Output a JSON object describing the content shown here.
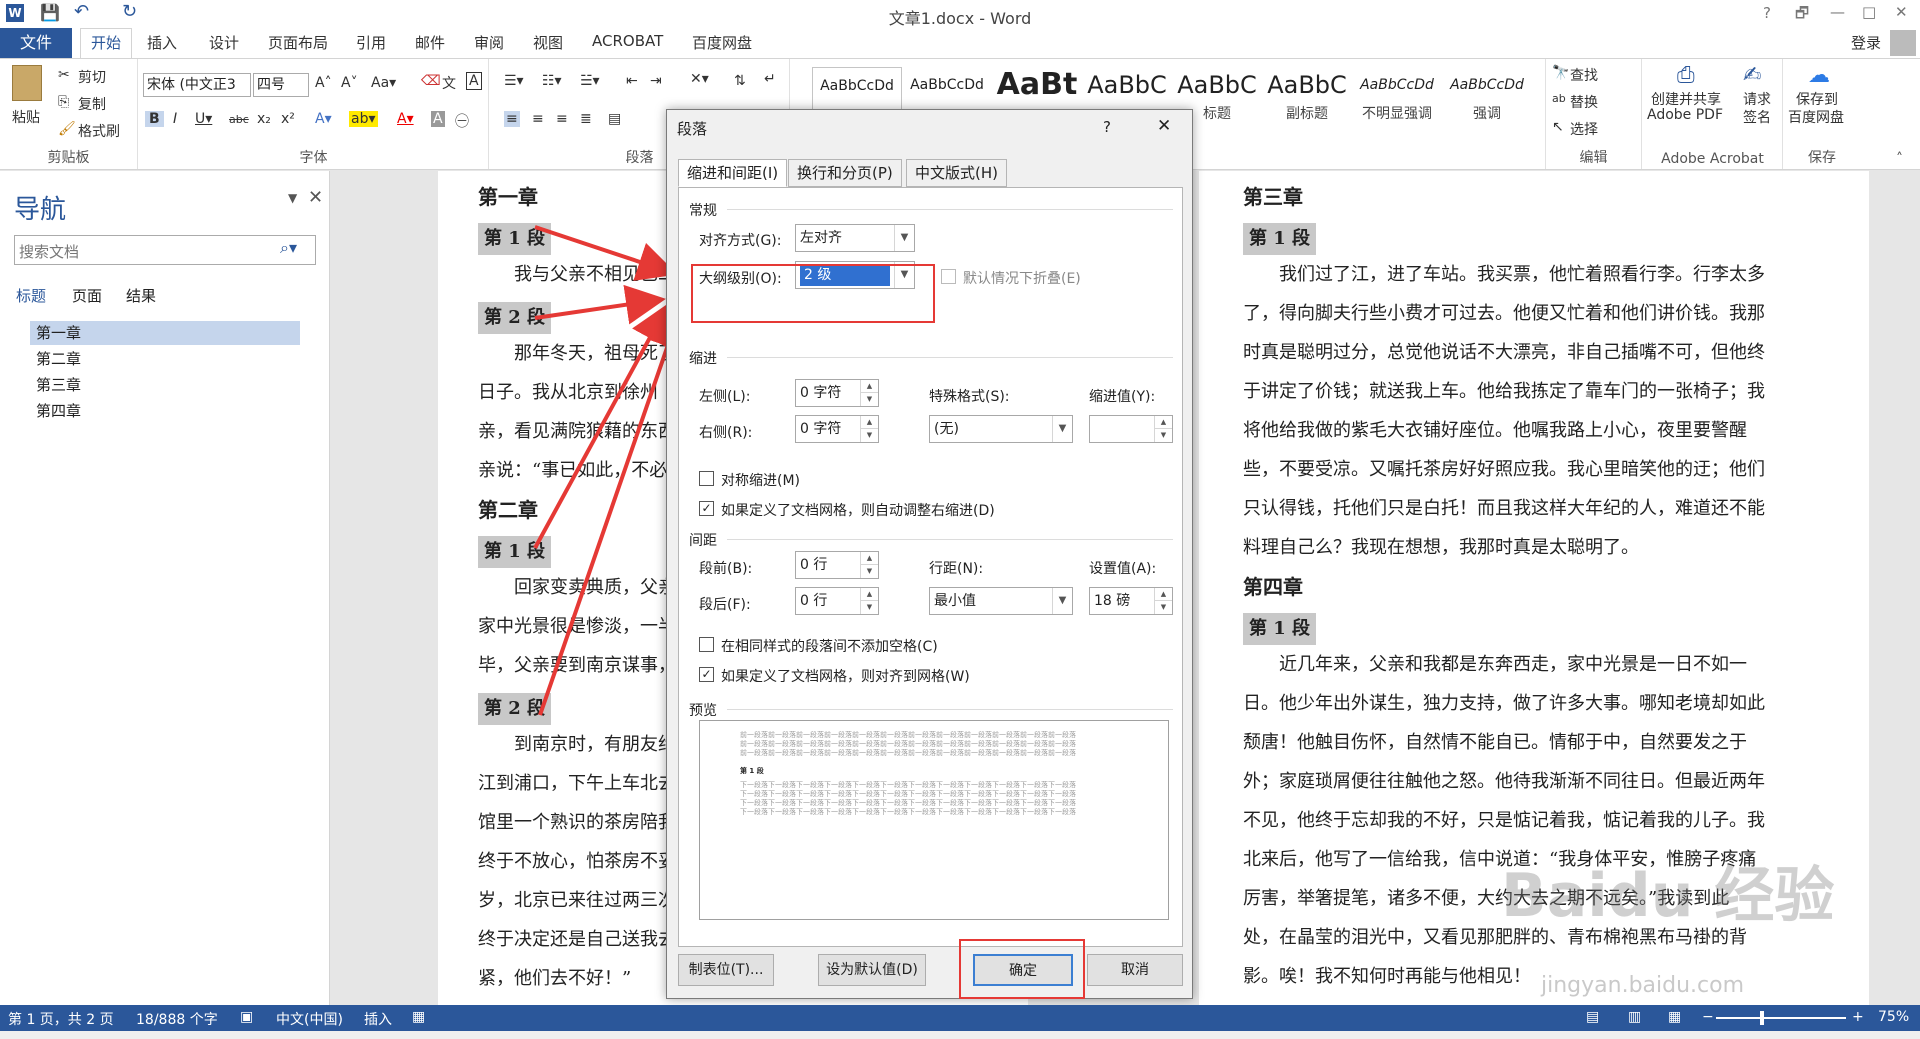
{
  "titlebar": {
    "doc_title": "文章1.docx - Word",
    "help": "?",
    "restore": "🗗",
    "minimize": "—",
    "maximize": "□",
    "close": "✕"
  },
  "tabs": {
    "file": "文件",
    "home": "开始",
    "insert": "插入",
    "design": "设计",
    "layout": "页面布局",
    "references": "引用",
    "mailings": "邮件",
    "review": "审阅",
    "view": "视图",
    "acrobat": "ACROBAT",
    "baidu": "百度网盘",
    "login": "登录"
  },
  "ribbon": {
    "paste": "粘贴",
    "cut": "剪切",
    "copy": "复制",
    "format_painter": "格式刷",
    "clipboard_label": "剪贴板",
    "font_name": "宋体 (中文正3",
    "font_size": "四号",
    "font_label": "字体",
    "paragraph_label": "段落",
    "styles": [
      {
        "preview": "AaBbCcDd",
        "label": ""
      },
      {
        "preview": "AaBbCcDd",
        "label": ""
      },
      {
        "preview": "AaBt",
        "label": ""
      },
      {
        "preview": "AaBbC",
        "label": ""
      },
      {
        "preview": "AaBbC",
        "label": "标题"
      },
      {
        "preview": "AaBbC",
        "label": "副标题"
      },
      {
        "preview": "AaBbCcDd",
        "label": "不明显强调"
      },
      {
        "preview": "AaBbCcDd",
        "label": "强调"
      }
    ],
    "find": "查找",
    "replace": "替换",
    "select": "选择",
    "edit_label": "编辑",
    "create_share_1": "创建并共享",
    "create_share_2": "Adobe PDF",
    "request_1": "请求",
    "request_2": "签名",
    "adobe_label": "Adobe Acrobat",
    "save_baidu_1": "保存到",
    "save_baidu_2": "百度网盘",
    "save_label": "保存"
  },
  "nav": {
    "title": "导航",
    "search_placeholder": "搜索文档",
    "tab_headings": "标题",
    "tab_pages": "页面",
    "tab_results": "结果",
    "items": [
      "第一章",
      "第二章",
      "第三章",
      "第四章"
    ]
  },
  "doc": {
    "left_lines": [
      {
        "t": "第一章",
        "k": "h1"
      },
      {
        "t": "第 1 段",
        "k": "h2"
      },
      {
        "t": "　　我与父亲不相见已二",
        "k": "p"
      },
      {
        "t": "第 2 段",
        "k": "h2"
      },
      {
        "t": "　　那年冬天，祖母死了",
        "k": "p"
      },
      {
        "t": "日子。我从北京到徐州",
        "k": "p"
      },
      {
        "t": "亲，看见满院狼藉的东西",
        "k": "p"
      },
      {
        "t": "亲说：“事已如此，不必",
        "k": "p"
      },
      {
        "t": "第二章",
        "k": "h1"
      },
      {
        "t": "第 1 段",
        "k": "h2"
      },
      {
        "t": "　　回家变卖典质，父亲",
        "k": "p"
      },
      {
        "t": "家中光景很是惨淡，一半",
        "k": "p"
      },
      {
        "t": "毕，父亲要到南京谋事，",
        "k": "p"
      },
      {
        "t": "第 2 段",
        "k": "h2"
      },
      {
        "t": "　　到南京时，有朋友约",
        "k": "p"
      },
      {
        "t": "江到浦口，下午上车北去",
        "k": "p"
      },
      {
        "t": "馆里一个熟识的茶房陪我",
        "k": "p"
      },
      {
        "t": "终于不放心，怕茶房不妥",
        "k": "p"
      },
      {
        "t": "岁，北京已来往过两三次",
        "k": "p"
      },
      {
        "t": "终于决定还是自己送我去",
        "k": "p"
      },
      {
        "t": "紧，他们去不好！”",
        "k": "p"
      }
    ],
    "right_lines": [
      {
        "t": "第三章",
        "k": "h1"
      },
      {
        "t": "第 1 段",
        "k": "h2"
      },
      {
        "t": "　　我们过了江，进了车站。我买票，他忙着照看行李。行李太多",
        "k": "p"
      },
      {
        "t": "了，得向脚夫行些小费才可过去。他便又忙着和他们讲价钱。我那",
        "k": "p"
      },
      {
        "t": "时真是聪明过分，总觉他说话不大漂亮，非自己插嘴不可，但他终",
        "k": "p"
      },
      {
        "t": "于讲定了价钱；就送我上车。他给我拣定了靠车门的一张椅子；我",
        "k": "p"
      },
      {
        "t": "将他给我做的紫毛大衣铺好座位。他嘱我路上小心，夜里要警醒",
        "k": "p"
      },
      {
        "t": "些，不要受凉。又嘱托茶房好好照应我。我心里暗笑他的迂；他们",
        "k": "p"
      },
      {
        "t": "只认得钱，托他们只是白托！而且我这样大年纪的人，难道还不能",
        "k": "p"
      },
      {
        "t": "料理自己么？我现在想想，我那时真是太聪明了。",
        "k": "p"
      },
      {
        "t": "第四章",
        "k": "h1"
      },
      {
        "t": "第 1 段",
        "k": "h2"
      },
      {
        "t": "　　近几年来，父亲和我都是东奔西走，家中光景是一日不如一",
        "k": "p"
      },
      {
        "t": "日。他少年出外谋生，独力支持，做了许多大事。哪知老境却如此",
        "k": "p"
      },
      {
        "t": "颓唐！他触目伤怀，自然情不能自已。情郁于中，自然要发之于",
        "k": "p"
      },
      {
        "t": "外；家庭琐屑便往往触他之怒。他待我渐渐不同往日。但最近两年",
        "k": "p"
      },
      {
        "t": "不见，他终于忘却我的不好，只是惦记着我，惦记着我的儿子。我",
        "k": "p"
      },
      {
        "t": "北来后，他写了一信给我，信中说道：“我身体平安，惟膀子疼痛",
        "k": "p"
      },
      {
        "t": "厉害，举箸提笔，诸多不便，大约大去之期不远矣。”我读到此",
        "k": "p"
      },
      {
        "t": "处，在晶莹的泪光中，又看见那肥胖的、青布棉袍黑布马褂的背",
        "k": "p"
      },
      {
        "t": "影。唉！我不知何时再能与他相见！",
        "k": "p"
      }
    ],
    "watermark": "Baidu 经验",
    "watermark_url": "jingyan.baidu.com"
  },
  "dialog": {
    "title": "段落",
    "help": "?",
    "close": "✕",
    "tabs": [
      "缩进和间距(I)",
      "换行和分页(P)",
      "中文版式(H)"
    ],
    "general": "常规",
    "alignment_label": "对齐方式(G):",
    "alignment_value": "左对齐",
    "outline_label": "大纲级别(O):",
    "outline_value": "2 级",
    "collapse_label": "默认情况下折叠(E)",
    "indent": "缩进",
    "left_label": "左侧(L):",
    "left_value": "0 字符",
    "right_label": "右侧(R):",
    "right_value": "0 字符",
    "special_label": "特殊格式(S):",
    "special_value": "(无)",
    "indent_by_label": "缩进值(Y):",
    "indent_by_value": "",
    "mirror_label": "对称缩进(M)",
    "auto_right_label": "如果定义了文档网格，则自动调整右缩进(D)",
    "spacing": "间距",
    "before_label": "段前(B):",
    "before_value": "0 行",
    "after_label": "段后(F):",
    "after_value": "0 行",
    "line_spacing_label": "行距(N):",
    "line_spacing_value": "最小值",
    "at_label": "设置值(A):",
    "at_value": "18 磅",
    "no_space_label": "在相同样式的段落间不添加空格(C)",
    "snap_grid_label": "如果定义了文档网格，则对齐到网格(W)",
    "preview": "预览",
    "preview_prev": "前一段落前一段落前一段落前一段落前一段落前一段落前一段落前一段落前一段落前一段落前一段落前一段落",
    "preview_cur": "第 1 段",
    "preview_next": "下一段落下一段落下一段落下一段落下一段落下一段落下一段落下一段落下一段落下一段落下一段落下一段落",
    "tabs_btn": "制表位(T)...",
    "default_btn": "设为默认值(D)",
    "ok_btn": "确定",
    "cancel_btn": "取消"
  },
  "status": {
    "page": "第 1 页，共 2 页",
    "words": "18/888 个字",
    "lang": "中文(中国)",
    "mode": "插入",
    "zoom": "75%"
  },
  "colors": {
    "accent": "#2b579a",
    "annotation": "#e53935"
  }
}
